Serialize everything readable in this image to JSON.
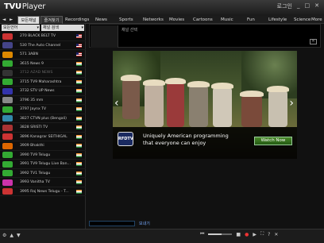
{
  "app": {
    "brand_tv": "TVU",
    "brand_player": "Player"
  },
  "window_controls": {
    "login": "로그인",
    "minimize": "_",
    "maximize": "□",
    "close": "✕"
  },
  "nav": {
    "back": "◄",
    "forward": "►",
    "tabs": [
      {
        "label": "모든채널",
        "active": true
      },
      {
        "label": "즐겨찾기",
        "active": false
      }
    ],
    "categories": [
      "Recordings",
      "News",
      "Sports",
      "Networks",
      "Movies",
      "Cartoons",
      "Music",
      "Fun",
      "Lifestyle",
      "Science",
      "More"
    ]
  },
  "filters": {
    "language": "모든언어",
    "search": "채널 검색"
  },
  "channels": [
    {
      "name": "270 BLACK BELT TV",
      "flag": "us",
      "color": "#c33",
      "dim": false
    },
    {
      "name": "530 The Auto Channel",
      "flag": "us",
      "color": "#448",
      "dim": false
    },
    {
      "name": "571 3ABN",
      "flag": "us",
      "color": "#d80",
      "dim": false
    },
    {
      "name": "3615 News 9",
      "flag": "in",
      "color": "#3a3",
      "dim": false
    },
    {
      "name": "3712 AZAD NEWS",
      "flag": "in",
      "color": "#333",
      "dim": true
    },
    {
      "name": "3715 TV9 Maharashtra",
      "flag": "in",
      "color": "#3a3",
      "dim": false
    },
    {
      "name": "3732 STV UP News",
      "flag": "in",
      "color": "#33a",
      "dim": false
    },
    {
      "name": "3796 35 mm",
      "flag": "in",
      "color": "#888",
      "dim": false
    },
    {
      "name": "3797 Jaynx TV",
      "flag": "in",
      "color": "#3a3",
      "dim": false
    },
    {
      "name": "3827 CTVN plus (Bengali)",
      "flag": "in",
      "color": "#38a",
      "dim": false
    },
    {
      "name": "3828 SRISTI TV",
      "flag": "in",
      "color": "#a33",
      "dim": false
    },
    {
      "name": "3896 Kanagrar SEITHIGAL",
      "flag": "in",
      "color": "#c33",
      "dim": false
    },
    {
      "name": "3909 Bhakthi",
      "flag": "in",
      "color": "#d60",
      "dim": false
    },
    {
      "name": "3990 TV9 Telugu",
      "flag": "in",
      "color": "#3a3",
      "dim": false
    },
    {
      "name": "3991 TV9 Telugu Live Ban...",
      "flag": "in",
      "color": "#3a3",
      "dim": false
    },
    {
      "name": "3992 TV1 Telugu",
      "flag": "in",
      "color": "#3a3",
      "dim": false
    },
    {
      "name": "3993 Vanitha TV",
      "flag": "in",
      "color": "#c3a",
      "dim": false
    },
    {
      "name": "3995 Raj News Telugu - T...",
      "flag": "in",
      "color": "#c33",
      "dim": false
    }
  ],
  "channel_info": {
    "title": "채널 선택",
    "close": "✕"
  },
  "ad": {
    "logo": "RFDTV",
    "line1": "Uniquely American programming",
    "line2": "that everyone can enjoy",
    "button": "Watch Now",
    "prev": "‹",
    "next": "›"
  },
  "bottom": {
    "left_buttons": [
      "⚙",
      "▲",
      "▼"
    ],
    "chat_label": "보내기",
    "controls": {
      "prev": "⏮",
      "stop": "■",
      "rec": "●",
      "play": "▶",
      "volume": 0.55,
      "fullscreen": "⛶",
      "help": "?",
      "exit": "✕"
    }
  }
}
